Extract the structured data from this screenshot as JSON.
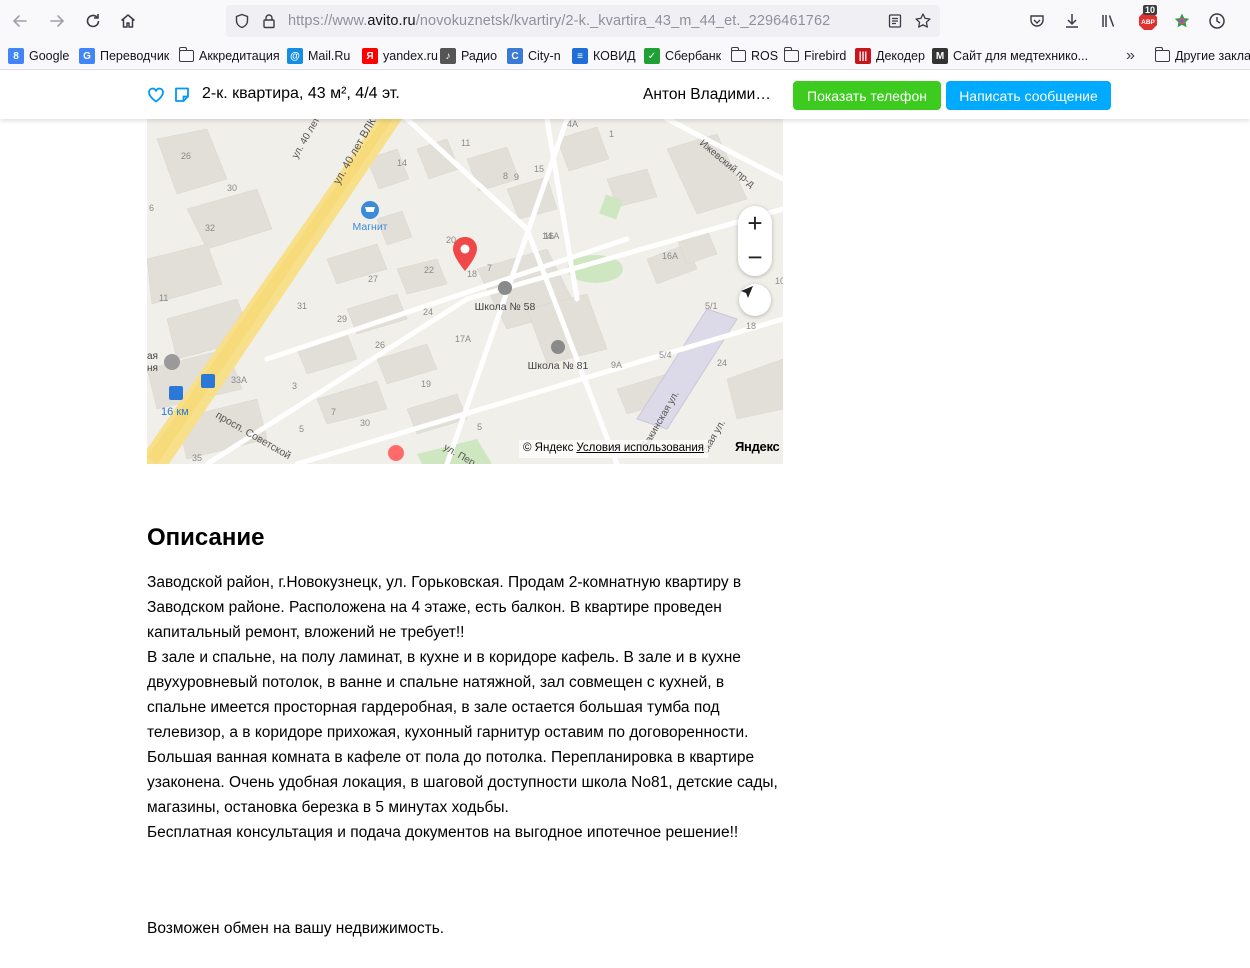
{
  "browser": {
    "url_prefix": "https://www.",
    "url_host": "avito.ru",
    "url_path": "/novokuznetsk/kvartiry/2-k._kvartira_43_m_44_et._2296461762",
    "adblock_count": "10",
    "abp_label": "ABP"
  },
  "bookmarks": [
    {
      "label": "Google",
      "color": "#4285f4",
      "glyph": "8"
    },
    {
      "label": "Переводчик",
      "color": "#4285f4",
      "glyph": "G"
    },
    {
      "label": "Аккредитация",
      "folder": true
    },
    {
      "label": "Mail.Ru",
      "color": "#168de2",
      "glyph": "@"
    },
    {
      "label": "yandex.ru",
      "color": "#ff0000",
      "glyph": "Я"
    },
    {
      "label": "Радио",
      "color": "#555555",
      "glyph": "♪"
    },
    {
      "label": "City-n",
      "color": "#3a7bd5",
      "glyph": "C"
    },
    {
      "label": "КОВИД",
      "color": "#1f6fd6",
      "glyph": "≡"
    },
    {
      "label": "Сбербанк",
      "color": "#21a038",
      "glyph": "✓"
    },
    {
      "label": "ROS",
      "folder": true
    },
    {
      "label": "Firebird",
      "folder": true
    },
    {
      "label": "Декодер",
      "color": "#c4161c",
      "glyph": "|||"
    },
    {
      "label": "Сайт для медтехнико...",
      "color": "#333333",
      "glyph": "M"
    }
  ],
  "bookmarks_other": "Другие заклад",
  "header": {
    "title": "2-к. квартира, 43 м², 4/4 эт.",
    "seller": "Антон Владими…",
    "phone_button": "Показать телефон",
    "message_button": "Написать сообщение"
  },
  "map": {
    "labels": {
      "magnit": "Магнит",
      "school58": "Школа № 58",
      "school81": "Школа № 81",
      "km16": "16 км",
      "street_40let": "ул. 40 лет ВЛКСМ",
      "street_40let_2": "ул. 40 лет",
      "street_sovetsky": "просп. Советской",
      "street_izhevsky": "Ижевский пр-д",
      "street_bakinskaya": "Бакинская ул.",
      "street_per": "ул. Пер",
      "street_right": "ская ул.",
      "left_label_1": "ая",
      "left_label_2": "ня"
    },
    "numbers": [
      "4А",
      "1",
      "11",
      "14",
      "15",
      "8",
      "9",
      "14",
      "7",
      "16",
      "11А",
      "20",
      "22",
      "18",
      "16А",
      "27",
      "24",
      "5/1",
      "31",
      "29",
      "18",
      "17А",
      "26",
      "5/4",
      "33А",
      "19",
      "9А",
      "24",
      "3",
      "30",
      "5",
      "7",
      "5",
      "35",
      "26",
      "6",
      "32",
      "30",
      "11",
      "10"
    ],
    "zoom_in": "+",
    "zoom_out": "−",
    "copyright": "© Яндекс",
    "terms": "Условия использования",
    "logo": "Яндекс"
  },
  "description": {
    "title": "Описание",
    "paragraphs": [
      "Заводской район, г.Новокузнецк, ул. Горьковская. Продам 2-комнатную квартиру в Заводском районе. Расположена на 4 этаже, есть балкон. В квартире проведен капитальный ремонт, вложений не требует!!",
      "В зале и спальне, на полу ламинат, в кухне и в коридоре кафель. В зале и в кухне двухуровневый потолок, в ванне и спальне натяжной, зал совмещен с кухней, в спальне имеется просторная гардеробная, в зале остается большая тумба под телевизор, а в коридоре прихожая, кухонный гарнитур оставим по договоренности. Большая ванная комната в кафеле от пола до потолка. Перепланировка в квартире узаконена. Очень удобная локация, в шаговой доступности школа No81, детские сады, магазины, остановка березка в 5 минутах ходьбы.",
      "Бесплатная консультация и подача документов на выгодное ипотечное решение!!"
    ],
    "extra": "Возможен обмен на вашу недвижимость."
  }
}
